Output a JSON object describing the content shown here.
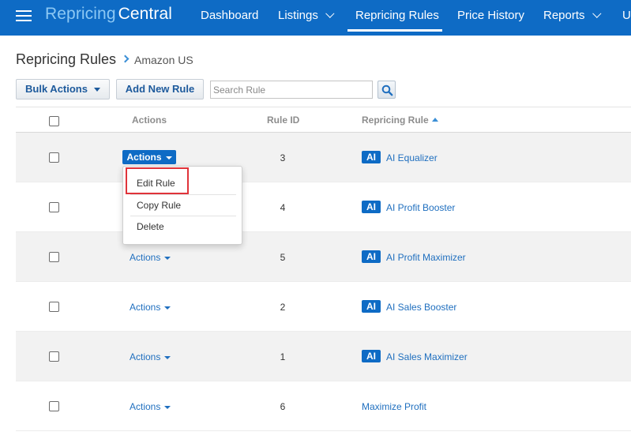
{
  "brand": {
    "part1": "Repricing",
    "part2": "Central"
  },
  "nav": {
    "dashboard": "Dashboard",
    "listings": "Listings",
    "repricing_rules": "Repricing Rules",
    "price_history": "Price History",
    "reports": "Reports",
    "overflow": "U"
  },
  "page": {
    "title": "Repricing Rules",
    "breadcrumb": "Amazon US"
  },
  "toolbar": {
    "bulk_actions": "Bulk Actions",
    "add_new_rule": "Add New Rule",
    "search_placeholder": "Search Rule"
  },
  "table": {
    "headers": {
      "actions": "Actions",
      "rule_id": "Rule ID",
      "repricing_rule": "Repricing Rule"
    },
    "ai_badge": "AI",
    "actions_label": "Actions",
    "rows": [
      {
        "id": "3",
        "name": "AI Equalizer",
        "ai": true
      },
      {
        "id": "4",
        "name": "AI Profit Booster",
        "ai": true
      },
      {
        "id": "5",
        "name": "AI Profit Maximizer",
        "ai": true
      },
      {
        "id": "2",
        "name": "AI Sales Booster",
        "ai": true
      },
      {
        "id": "1",
        "name": "AI Sales Maximizer",
        "ai": true
      },
      {
        "id": "6",
        "name": "Maximize Profit",
        "ai": false
      }
    ]
  },
  "dropdown": {
    "edit": "Edit Rule",
    "copy": "Copy Rule",
    "delete": "Delete"
  },
  "colors": {
    "brand_blue": "#0e6bc5",
    "link_blue": "#1f6fbf",
    "highlight_red": "#e0333a"
  }
}
